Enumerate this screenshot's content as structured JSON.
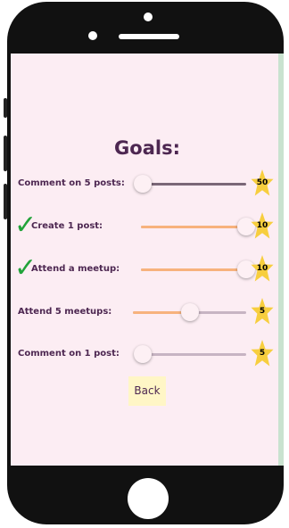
{
  "header": {
    "title": "Goals:"
  },
  "goals": [
    {
      "label": "Comment on 5 posts:",
      "completed": false,
      "progress": 0.0,
      "reward": "50"
    },
    {
      "label": "Create 1 post:",
      "completed": true,
      "progress": 1.0,
      "reward": "10"
    },
    {
      "label": "Attend a meetup:",
      "completed": true,
      "progress": 1.0,
      "reward": "10"
    },
    {
      "label": "Attend 5 meetups:",
      "completed": false,
      "progress": 0.5,
      "reward": "5"
    },
    {
      "label": "Comment on 1 post:",
      "completed": false,
      "progress": 0.0,
      "reward": "5"
    }
  ],
  "back_label": "Back",
  "colors": {
    "title": "#4d2751",
    "check": "#22a33a",
    "fill_active": "#f7b27d",
    "track_inactive": "#c7b4c3",
    "track_dark": "#7a6777",
    "star": "#f7ce3e",
    "screen_bg": "#fcedf3"
  },
  "icons": {
    "check": "check-icon",
    "star": "star-icon"
  }
}
